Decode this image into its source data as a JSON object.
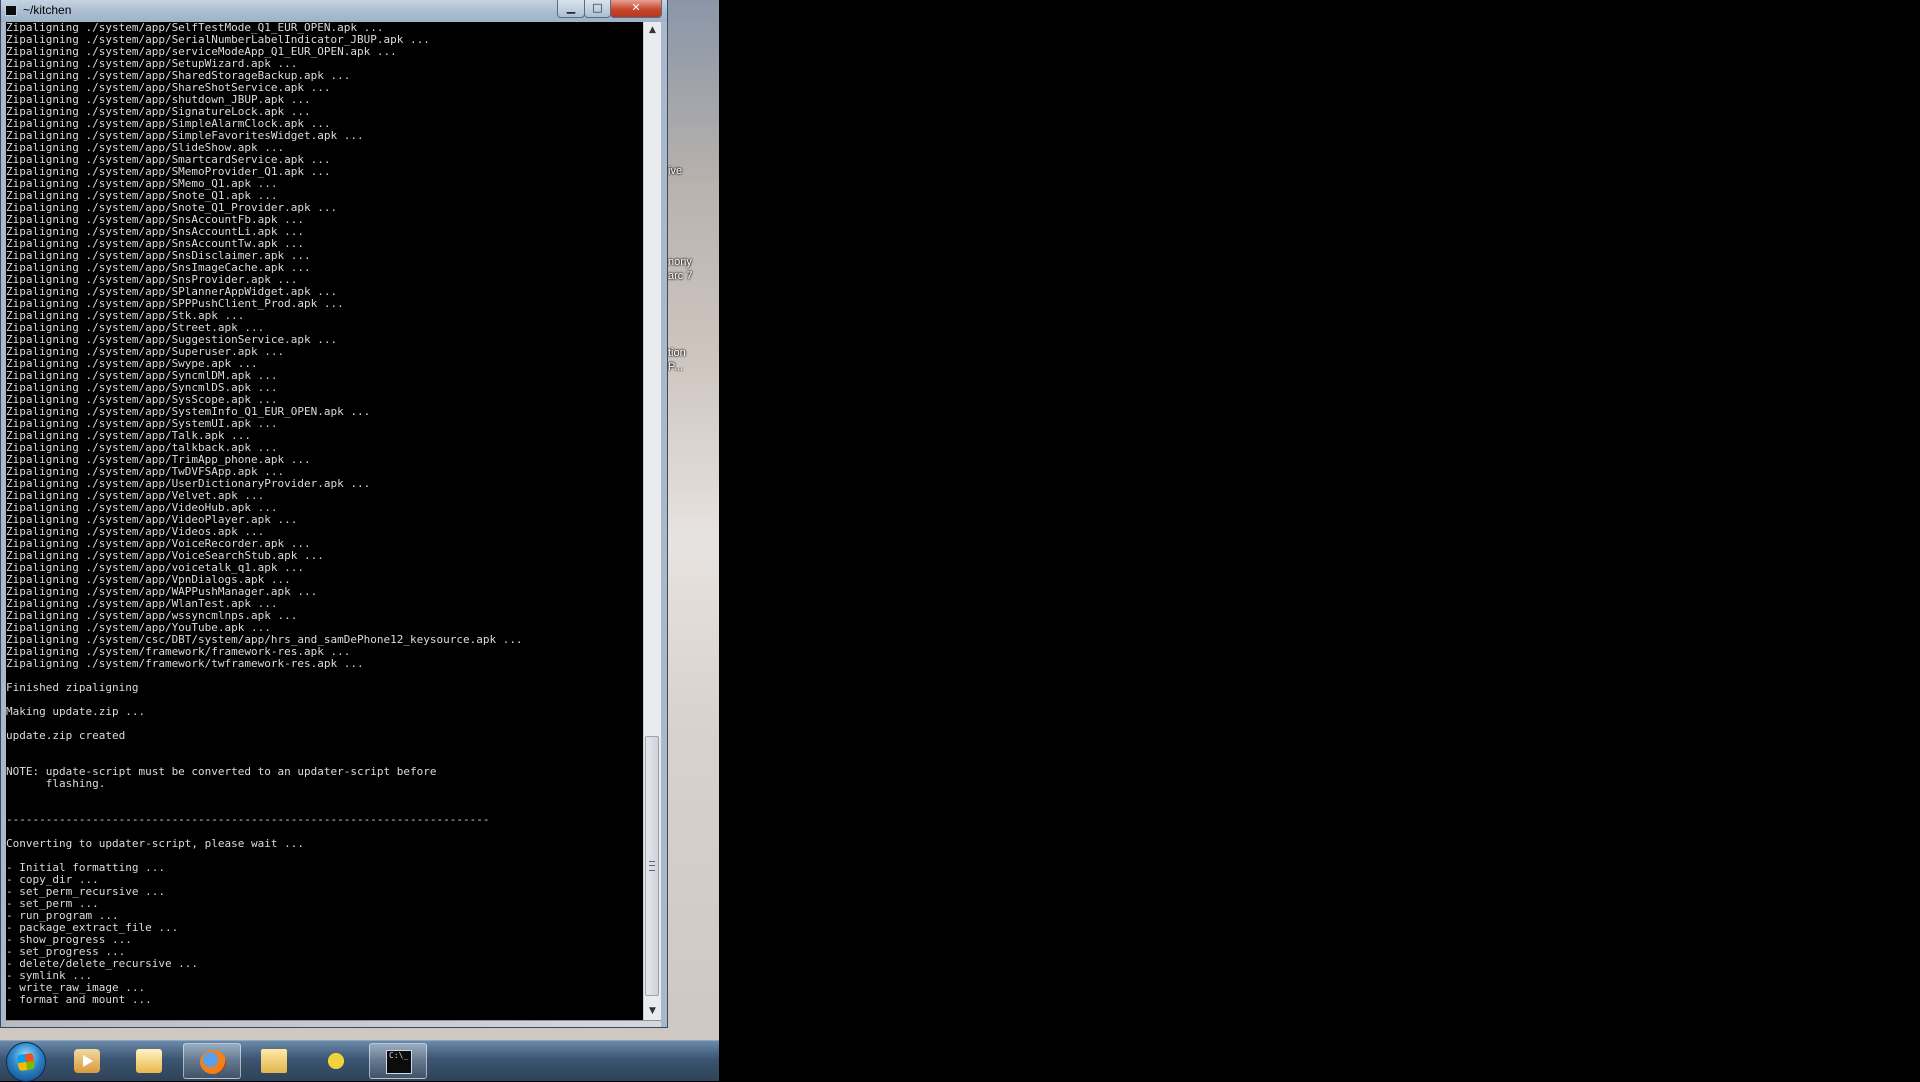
{
  "window": {
    "title": "~/kitchen",
    "buttons": {
      "minimize": "▁",
      "maximize": "□",
      "close": "✕"
    }
  },
  "desktop": {
    "labels": [
      "ive",
      "nony",
      "arc 7",
      "tion",
      "P..."
    ]
  },
  "console": {
    "lines": [
      "Zipaligning ./system/app/SelfTestMode_Q1_EUR_OPEN.apk ...",
      "Zipaligning ./system/app/SerialNumberLabelIndicator_JBUP.apk ...",
      "Zipaligning ./system/app/serviceModeApp_Q1_EUR_OPEN.apk ...",
      "Zipaligning ./system/app/SetupWizard.apk ...",
      "Zipaligning ./system/app/SharedStorageBackup.apk ...",
      "Zipaligning ./system/app/ShareShotService.apk ...",
      "Zipaligning ./system/app/shutdown_JBUP.apk ...",
      "Zipaligning ./system/app/SignatureLock.apk ...",
      "Zipaligning ./system/app/SimpleAlarmClock.apk ...",
      "Zipaligning ./system/app/SimpleFavoritesWidget.apk ...",
      "Zipaligning ./system/app/SlideShow.apk ...",
      "Zipaligning ./system/app/SmartcardService.apk ...",
      "Zipaligning ./system/app/SMemoProvider_Q1.apk ...",
      "Zipaligning ./system/app/SMemo_Q1.apk ...",
      "Zipaligning ./system/app/Snote_Q1.apk ...",
      "Zipaligning ./system/app/Snote_Q1_Provider.apk ...",
      "Zipaligning ./system/app/SnsAccountFb.apk ...",
      "Zipaligning ./system/app/SnsAccountLi.apk ...",
      "Zipaligning ./system/app/SnsAccountTw.apk ...",
      "Zipaligning ./system/app/SnsDisclaimer.apk ...",
      "Zipaligning ./system/app/SnsImageCache.apk ...",
      "Zipaligning ./system/app/SnsProvider.apk ...",
      "Zipaligning ./system/app/SPlannerAppWidget.apk ...",
      "Zipaligning ./system/app/SPPPushClient_Prod.apk ...",
      "Zipaligning ./system/app/Stk.apk ...",
      "Zipaligning ./system/app/Street.apk ...",
      "Zipaligning ./system/app/SuggestionService.apk ...",
      "Zipaligning ./system/app/Superuser.apk ...",
      "Zipaligning ./system/app/Swype.apk ...",
      "Zipaligning ./system/app/SyncmlDM.apk ...",
      "Zipaligning ./system/app/SyncmlDS.apk ...",
      "Zipaligning ./system/app/SysScope.apk ...",
      "Zipaligning ./system/app/SystemInfo_Q1_EUR_OPEN.apk ...",
      "Zipaligning ./system/app/SystemUI.apk ...",
      "Zipaligning ./system/app/Talk.apk ...",
      "Zipaligning ./system/app/talkback.apk ...",
      "Zipaligning ./system/app/TrimApp_phone.apk ...",
      "Zipaligning ./system/app/TwDVFSApp.apk ...",
      "Zipaligning ./system/app/UserDictionaryProvider.apk ...",
      "Zipaligning ./system/app/Velvet.apk ...",
      "Zipaligning ./system/app/VideoHub.apk ...",
      "Zipaligning ./system/app/VideoPlayer.apk ...",
      "Zipaligning ./system/app/Videos.apk ...",
      "Zipaligning ./system/app/VoiceRecorder.apk ...",
      "Zipaligning ./system/app/VoiceSearchStub.apk ...",
      "Zipaligning ./system/app/voicetalk_q1.apk ...",
      "Zipaligning ./system/app/VpnDialogs.apk ...",
      "Zipaligning ./system/app/WAPPushManager.apk ...",
      "Zipaligning ./system/app/WlanTest.apk ...",
      "Zipaligning ./system/app/wssyncmlnps.apk ...",
      "Zipaligning ./system/app/YouTube.apk ...",
      "Zipaligning ./system/csc/DBT/system/app/hrs_and_samDePhone12_keysource.apk ...",
      "Zipaligning ./system/framework/framework-res.apk ...",
      "Zipaligning ./system/framework/twframework-res.apk ...",
      "",
      "Finished zipaligning",
      "",
      "Making update.zip ...",
      "",
      "update.zip created",
      "",
      "",
      "NOTE: update-script must be converted to an updater-script before",
      "      flashing.",
      "",
      "",
      "-------------------------------------------------------------------------",
      "",
      "Converting to updater-script, please wait ...",
      "",
      "- Initial formatting ...",
      "- copy_dir ...",
      "- set_perm_recursive ...",
      "- set_perm ...",
      "- run_program ...",
      "- package_extract_file ...",
      "- show_progress ...",
      "- set_progress ...",
      "- delete/delete_recursive ...",
      "- symlink ...",
      "- write_raw_image ...",
      "- format and mount ..."
    ]
  },
  "taskbar": {
    "items": [
      {
        "name": "start-button-icon",
        "active": false
      },
      {
        "name": "media-player-icon",
        "active": false
      },
      {
        "name": "mail-icon",
        "active": false
      },
      {
        "name": "firefox-icon",
        "active": true
      },
      {
        "name": "file-explorer-icon",
        "active": false
      },
      {
        "name": "biohazard-icon",
        "active": false
      },
      {
        "name": "command-prompt-icon",
        "active": true
      }
    ],
    "cmd_icon_text": "C:\\_"
  }
}
